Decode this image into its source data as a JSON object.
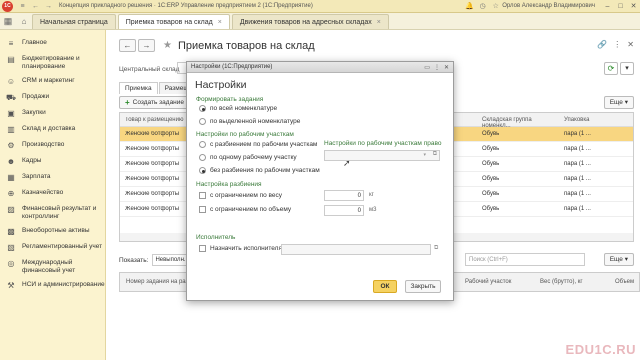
{
  "titlebar": {
    "title": "Концепция прикладного решения · 1С:ERP Управление предприятием 2   (1С:Предприятие)",
    "user": "Орлов Александр Владимирович"
  },
  "tabs": [
    {
      "label": "Начальная страница",
      "active": false
    },
    {
      "label": "Приемка товаров на склад",
      "active": true
    },
    {
      "label": "Движения товаров на адресных складах",
      "active": false
    }
  ],
  "sidebar": {
    "items": [
      {
        "label": "Главное",
        "icon": "home-lines-icon"
      },
      {
        "label": "Бюджетирование и планирование",
        "icon": "budget-icon"
      },
      {
        "label": "CRM и маркетинг",
        "icon": "crm-icon"
      },
      {
        "label": "Продажи",
        "icon": "cart-icon"
      },
      {
        "label": "Закупки",
        "icon": "purchase-icon"
      },
      {
        "label": "Склад и доставка",
        "icon": "warehouse-icon"
      },
      {
        "label": "Производство",
        "icon": "factory-icon"
      },
      {
        "label": "Кадры",
        "icon": "people-icon"
      },
      {
        "label": "Зарплата",
        "icon": "salary-icon"
      },
      {
        "label": "Казначейство",
        "icon": "treasury-icon"
      },
      {
        "label": "Финансовый результат и контроллинг",
        "icon": "finance-icon"
      },
      {
        "label": "Внеоборотные активы",
        "icon": "assets-icon"
      },
      {
        "label": "Регламентированный учет",
        "icon": "accounting-icon"
      },
      {
        "label": "Международный финансовый учет",
        "icon": "intl-icon"
      },
      {
        "label": "НСИ и администрирование",
        "icon": "admin-icon"
      }
    ]
  },
  "main": {
    "page_title": "Приемка товаров на склад",
    "warehouse_label": "Центральный склад",
    "subtabs": [
      "Приемка",
      "Размещение"
    ],
    "create_button": "Создать задание",
    "more_label": "Еще",
    "grid": {
      "headers": [
        "Товар к размещению",
        "Складская группа номенкл...",
        "Упаковка"
      ],
      "rows": [
        {
          "item": "Женские ботфорты",
          "group": "Обувь",
          "pack": "пара (1 ..."
        },
        {
          "item": "Женские ботфорты",
          "group": "Обувь",
          "pack": "пара (1 ..."
        },
        {
          "item": "Женские ботфорты",
          "group": "Обувь",
          "pack": "пара (1 ..."
        },
        {
          "item": "Женские ботфорты",
          "group": "Обувь",
          "pack": "пара (1 ..."
        },
        {
          "item": "Женские ботфорты",
          "group": "Обувь",
          "pack": "пара (1 ..."
        },
        {
          "item": "Женские ботфорты",
          "group": "Обувь",
          "pack": "пара (1 ..."
        }
      ]
    },
    "show_label": "Показать:",
    "show_value": "Невыполн...",
    "search_placeholder": "Поиск (Ctrl+F)",
    "grid2_headers": [
      "Номер задания на размещ...",
      "Рабочий участок",
      "Вес (брутто), кг",
      "Объем"
    ]
  },
  "dialog": {
    "window_title": "Настройки  (1С:Предприятие)",
    "heading": "Настройки",
    "group_tasks": "Формировать задания",
    "opt_all": "по всей номенклатуре",
    "opt_selected": "по выделенной номенклатуре",
    "group_areas": "Настройки по рабочим участкам",
    "opt_split": "с разбиением по рабочим участкам",
    "opt_one": "по одному рабочему участку",
    "opt_nosplit": "без разбиения по рабочим участкам",
    "right_label": "Настройки по рабочим участкам право",
    "group_split": "Настройка разбиения",
    "chk_weight": "с ограничением по весу",
    "chk_volume": "с ограничением по объему",
    "weight_value": "0",
    "weight_unit": "кг",
    "volume_value": "0",
    "volume_unit": "м3",
    "group_executor": "Исполнитель",
    "chk_executor": "Назначить исполнителя",
    "ok_label": "ОК",
    "close_label": "Закрыть"
  },
  "watermark": "EDU1C.RU"
}
